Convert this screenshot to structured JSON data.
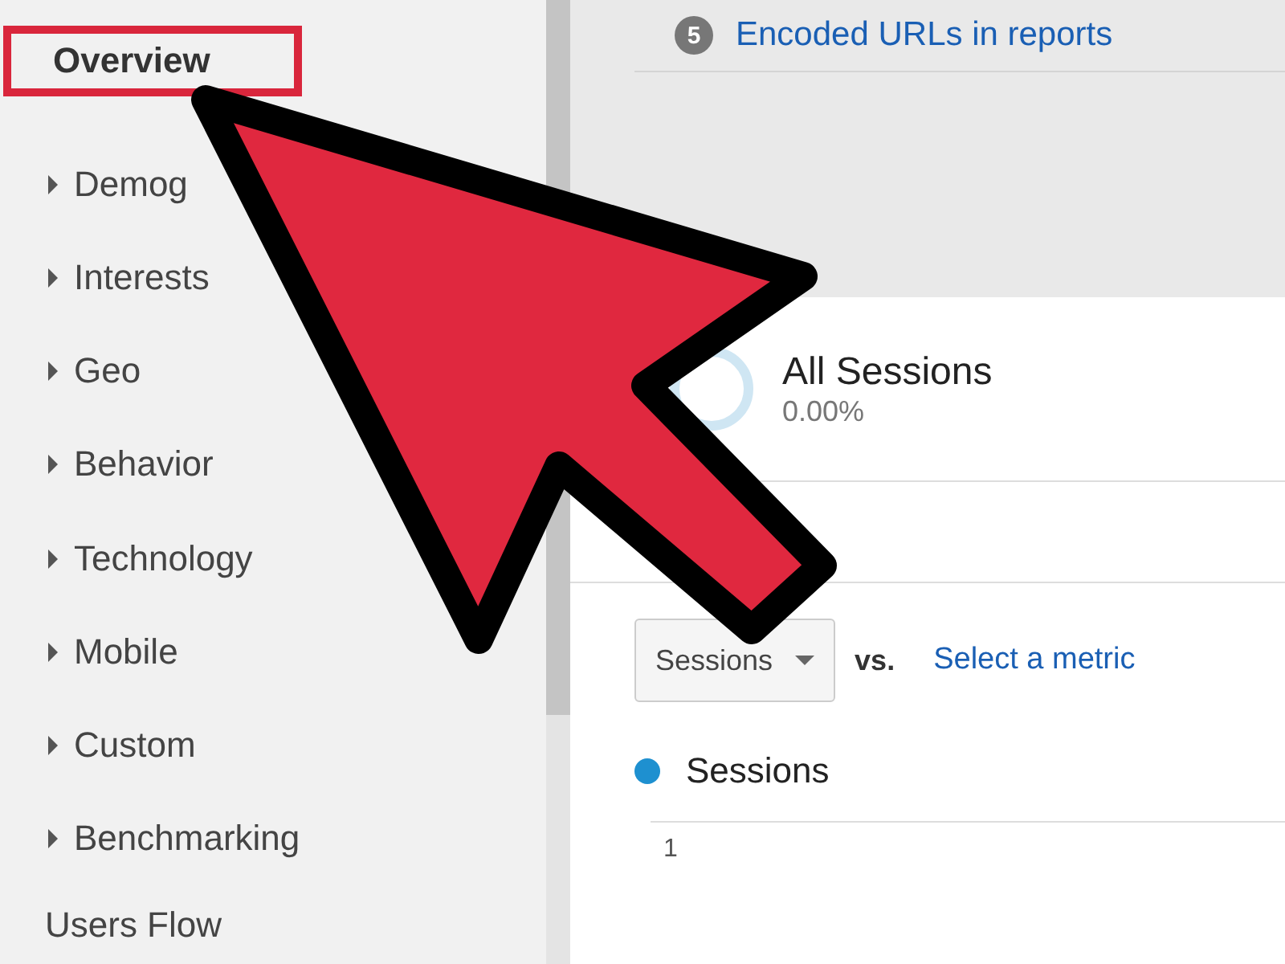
{
  "sidebar": {
    "items": [
      {
        "label": "Overview",
        "kind": "heading",
        "expandable": false,
        "highlighted": true
      },
      {
        "label": "Demog",
        "expandable": true,
        "highlighted": false
      },
      {
        "label": "Interests",
        "expandable": true,
        "highlighted": false
      },
      {
        "label": "Geo",
        "expandable": true,
        "highlighted": false
      },
      {
        "label": "Behavior",
        "expandable": true,
        "highlighted": false
      },
      {
        "label": "Technology",
        "expandable": true,
        "highlighted": false
      },
      {
        "label": "Mobile",
        "expandable": true,
        "highlighted": false
      },
      {
        "label": "Custom",
        "expandable": true,
        "highlighted": false
      },
      {
        "label": "Benchmarking",
        "expandable": true,
        "highlighted": false
      },
      {
        "label": "Users Flow",
        "expandable": false,
        "highlighted": false
      }
    ]
  },
  "notice": {
    "badge": "5",
    "link": "Encoded URLs in reports"
  },
  "segment": {
    "name": "All Sessions",
    "percent": "0.00%"
  },
  "chart_controls": {
    "metric": "Sessions",
    "vs": "vs.",
    "compare_link": "Select a metric"
  },
  "legend": [
    {
      "label": "Sessions",
      "color": "#1e90d0"
    }
  ],
  "axis": {
    "first_tick": "1"
  }
}
